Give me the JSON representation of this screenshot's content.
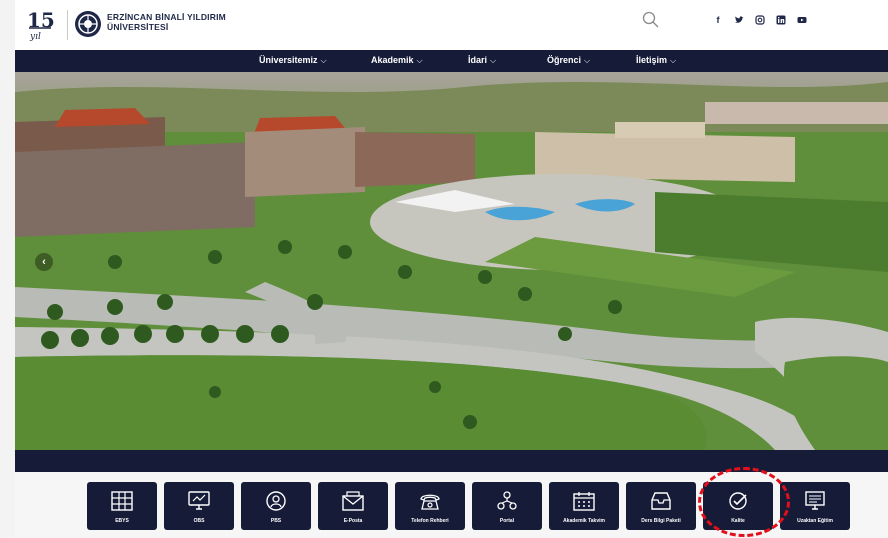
{
  "header": {
    "logo_number": "15",
    "logo_script": "yıl",
    "university_line1": "ERZİNCAN BİNALİ YILDIRIM",
    "university_line2": "ÜNİVERSİTESİ",
    "icons": [
      "search-icon",
      "facebook-icon",
      "twitter-icon",
      "instagram-icon",
      "linkedin-icon",
      "youtube-icon"
    ]
  },
  "nav": {
    "items": [
      {
        "label": "Üniversitemiz"
      },
      {
        "label": "Akademik"
      },
      {
        "label": "İdari"
      },
      {
        "label": "Öğrenci"
      },
      {
        "label": "İletişim"
      }
    ]
  },
  "hero": {
    "prev_arrow": "‹"
  },
  "quick_links": [
    {
      "label": "EBYS",
      "icon": "grid-stack-icon"
    },
    {
      "label": "OBS",
      "icon": "monitor-icon"
    },
    {
      "label": "PBS",
      "icon": "user-badge-icon"
    },
    {
      "label": "E-Posta",
      "icon": "envelope-icon"
    },
    {
      "label": "Telefon Rehberi",
      "icon": "telephone-icon"
    },
    {
      "label": "Portal",
      "icon": "network-icon"
    },
    {
      "label": "Akademik Takvim",
      "icon": "calendar-icon"
    },
    {
      "label": "Ders Bilgi Paketi",
      "icon": "inbox-icon"
    },
    {
      "label": "Kalite",
      "icon": "check-badge-icon"
    },
    {
      "label": "Uzaktan Eğitim",
      "icon": "distance-monitor-icon"
    }
  ],
  "colors": {
    "navy": "#161b38",
    "highlight": "#e1101b"
  }
}
